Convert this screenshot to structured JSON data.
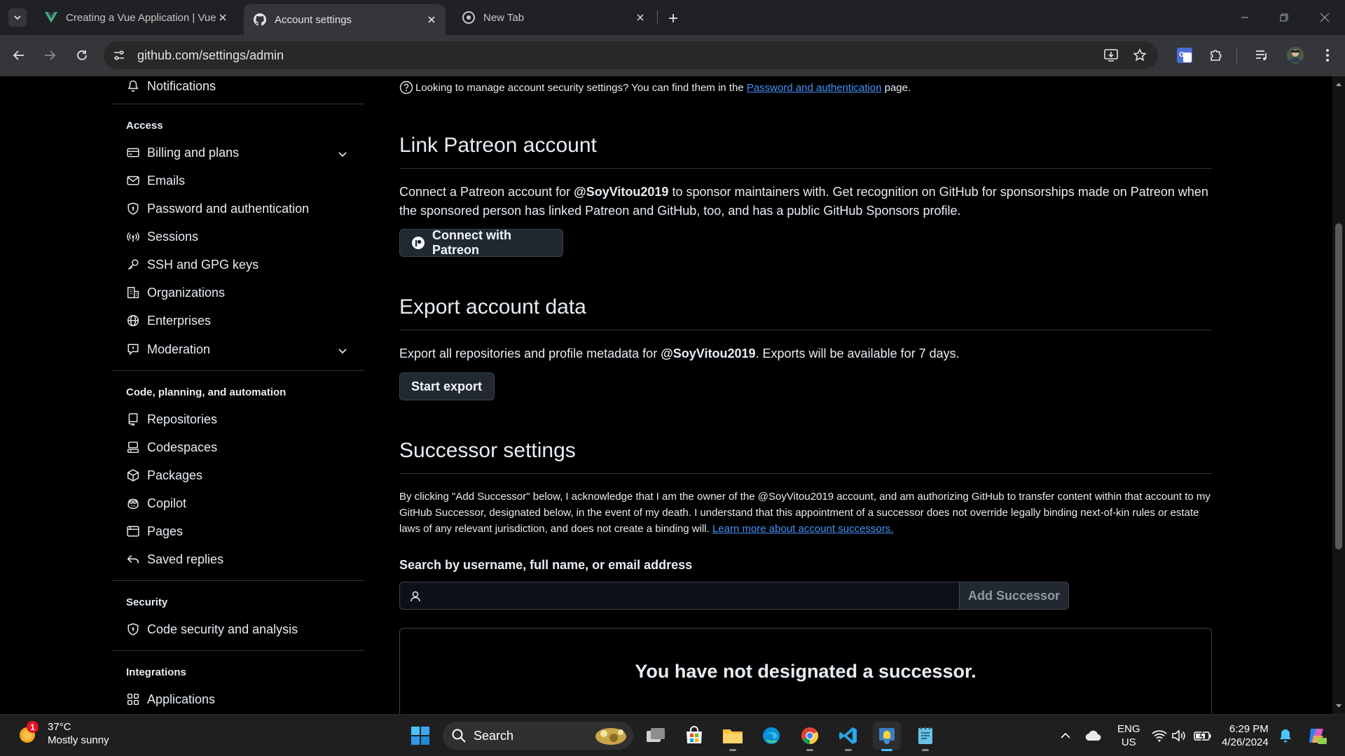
{
  "browser": {
    "tabs": [
      {
        "title": "Creating a Vue Application | Vue",
        "favicon": "vue-logo"
      },
      {
        "title": "Account settings",
        "favicon": "github-logo"
      },
      {
        "title": "New Tab",
        "favicon": "chrome-logo"
      }
    ],
    "url": "github.com/settings/admin"
  },
  "sidebar": {
    "top_item": "Notifications",
    "sections": [
      {
        "heading": "Access",
        "items": [
          "Billing and plans",
          "Emails",
          "Password and authentication",
          "Sessions",
          "SSH and GPG keys",
          "Organizations",
          "Enterprises",
          "Moderation"
        ]
      },
      {
        "heading": "Code, planning, and automation",
        "items": [
          "Repositories",
          "Codespaces",
          "Packages",
          "Copilot",
          "Pages",
          "Saved replies"
        ]
      },
      {
        "heading": "Security",
        "items": [
          "Code security and analysis"
        ]
      },
      {
        "heading": "Integrations",
        "items": [
          "Applications"
        ]
      }
    ]
  },
  "main": {
    "security_note": {
      "text": "Looking to manage account security settings? You can find them in the",
      "link": "Password and authentication",
      "suffix": "page."
    },
    "patreon": {
      "title": "Link Patreon account",
      "desc_prefix": "Connect a Patreon account for",
      "username": "@SoyVitou2019",
      "desc_suffix": "to sponsor maintainers with. Get recognition on GitHub for sponsorships made on Patreon when the sponsored person has linked Patreon and GitHub, too, and has a public GitHub Sponsors profile.",
      "button": "Connect with Patreon"
    },
    "export": {
      "title": "Export account data",
      "desc_prefix": "Export all repositories and profile metadata for",
      "username": "@SoyVitou2019",
      "desc_suffix": ". Exports will be available for 7 days.",
      "button": "Start export"
    },
    "successor": {
      "title": "Successor settings",
      "desc": "By clicking \"Add Successor\" below, I acknowledge that I am the owner of the @SoyVitou2019 account, and am authorizing GitHub to transfer content within that account to my GitHub Successor, designated below, in the event of my death. I understand that this appointment of a successor does not override legally binding next-of-kin rules or estate laws of any relevant jurisdiction, and does not create a binding will.",
      "link": "Learn more about account successors.",
      "search_label": "Search by username, full name, or email address",
      "search_value": "",
      "add_button": "Add Successor",
      "empty_message": "You have not designated a successor."
    }
  },
  "taskbar": {
    "weather": {
      "temp": "37°C",
      "desc": "Mostly sunny",
      "badge": "1"
    },
    "search_label": "Search",
    "lang": {
      "line1": "ENG",
      "line2": "US"
    },
    "time": "6:29 PM",
    "date": "4/26/2024"
  }
}
